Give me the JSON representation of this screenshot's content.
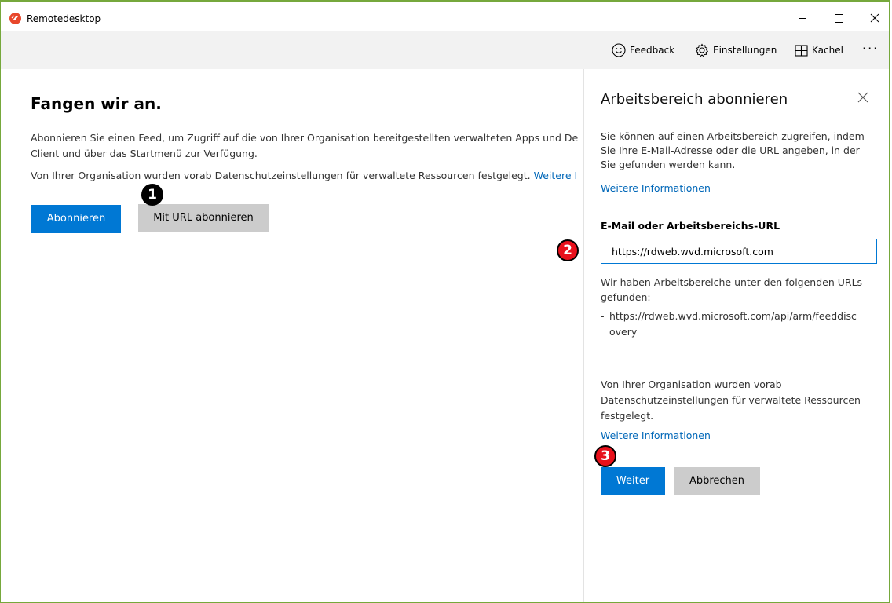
{
  "window": {
    "title": "Remotedesktop",
    "accent_border": "#76a83c",
    "icon_color": "#e8472b"
  },
  "toolbar": {
    "feedback_label": "Feedback",
    "settings_label": "Einstellungen",
    "tile_label": "Kachel",
    "more_label": "···"
  },
  "main": {
    "title": "Fangen wir an.",
    "description_line1": "Abonnieren Sie einen Feed, um Zugriff auf die von Ihrer Organisation bereitgestellten verwalteten Apps und De",
    "description_line2": "Client und über das Startmenü zur Verfügung.",
    "privacy_text": "Von Ihrer Organisation wurden vorab Datenschutzeinstellungen für verwaltete Ressourcen festgelegt.",
    "privacy_link": "Weitere I",
    "subscribe_label": "Abonnieren",
    "subscribe_url_label": "Mit URL abonnieren"
  },
  "panel": {
    "title": "Arbeitsbereich abonnieren",
    "description": "Sie können auf einen Arbeitsbereich zugreifen, indem Sie Ihre E-Mail-Adresse oder die URL angeben, in der Sie gefunden werden kann.",
    "more_info_link": "Weitere Informationen",
    "field_label": "E-Mail oder Arbeitsbereichs-URL",
    "field_value": "https://rdweb.wvd.microsoft.com",
    "found_text": "Wir haben Arbeitsbereiche unter den folgenden URLs gefunden:",
    "found_dash": "-",
    "found_url": "https://rdweb.wvd.microsoft.com/api/arm/feeddiscovery",
    "privacy_text": "Von Ihrer Organisation wurden vorab Datenschutzeinstellungen für verwaltete Ressourcen festgelegt.",
    "privacy_link": "Weitere Informationen",
    "next_label": "Weiter",
    "cancel_label": "Abbrechen"
  },
  "callouts": {
    "one": "1",
    "two": "2",
    "three": "3",
    "color": "#e8101b"
  },
  "colors": {
    "primary_button": "#0078d4",
    "secondary_button": "#cccccc",
    "link": "#0067b8",
    "toolbar_bg": "#f2f2f2"
  }
}
